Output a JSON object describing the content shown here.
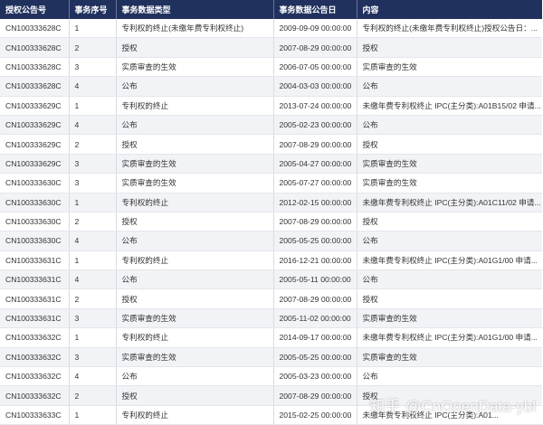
{
  "table": {
    "headers": [
      "授权公告号",
      "事务序号",
      "事务数据类型",
      "事务数据公告日",
      "内容"
    ],
    "rows": [
      [
        "CN100333628C",
        "1",
        "专利权的终止(未缴年费专利权终止)",
        "2009-09-09 00:00:00",
        "专利权的终止(未缴年费专利权终止)授权公告日：..."
      ],
      [
        "CN100333628C",
        "2",
        "授权",
        "2007-08-29 00:00:00",
        "授权"
      ],
      [
        "CN100333628C",
        "3",
        "实质审查的生效",
        "2006-07-05 00:00:00",
        "实质审查的生效"
      ],
      [
        "CN100333628C",
        "4",
        "公布",
        "2004-03-03 00:00:00",
        "公布"
      ],
      [
        "CN100333629C",
        "1",
        "专利权的终止",
        "2013-07-24 00:00:00",
        "未缴年费专利权终止 IPC(主分类):A01B15/02 申请..."
      ],
      [
        "CN100333629C",
        "4",
        "公布",
        "2005-02-23 00:00:00",
        "公布"
      ],
      [
        "CN100333629C",
        "2",
        "授权",
        "2007-08-29 00:00:00",
        "授权"
      ],
      [
        "CN100333629C",
        "3",
        "实质审查的生效",
        "2005-04-27 00:00:00",
        "实质审查的生效"
      ],
      [
        "CN100333630C",
        "3",
        "实质审查的生效",
        "2005-07-27 00:00:00",
        "实质审查的生效"
      ],
      [
        "CN100333630C",
        "1",
        "专利权的终止",
        "2012-02-15 00:00:00",
        "未缴年费专利权终止 IPC(主分类):A01C11/02 申请..."
      ],
      [
        "CN100333630C",
        "2",
        "授权",
        "2007-08-29 00:00:00",
        "授权"
      ],
      [
        "CN100333630C",
        "4",
        "公布",
        "2005-05-25 00:00:00",
        "公布"
      ],
      [
        "CN100333631C",
        "1",
        "专利权的终止",
        "2016-12-21 00:00:00",
        "未缴年费专利权终止 IPC(主分类):A01G1/00 申请..."
      ],
      [
        "CN100333631C",
        "4",
        "公布",
        "2005-05-11 00:00:00",
        "公布"
      ],
      [
        "CN100333631C",
        "2",
        "授权",
        "2007-08-29 00:00:00",
        "授权"
      ],
      [
        "CN100333631C",
        "3",
        "实质审查的生效",
        "2005-11-02 00:00:00",
        "实质审查的生效"
      ],
      [
        "CN100333632C",
        "1",
        "专利权的终止",
        "2014-09-17 00:00:00",
        "未缴年费专利权终止 IPC(主分类):A01G1/00 申请..."
      ],
      [
        "CN100333632C",
        "3",
        "实质审查的生效",
        "2005-05-25 00:00:00",
        "实质审查的生效"
      ],
      [
        "CN100333632C",
        "4",
        "公布",
        "2005-03-23 00:00:00",
        "公布"
      ],
      [
        "CN100333632C",
        "2",
        "授权",
        "2007-08-29 00:00:00",
        "授权"
      ],
      [
        "CN100333633C",
        "1",
        "专利权的终止",
        "2015-02-25 00:00:00",
        "未缴年费专利权终止 IPC(主分类):A01..."
      ]
    ]
  },
  "watermark": {
    "site": "知乎",
    "author": "@CnOpenData-ybl"
  }
}
